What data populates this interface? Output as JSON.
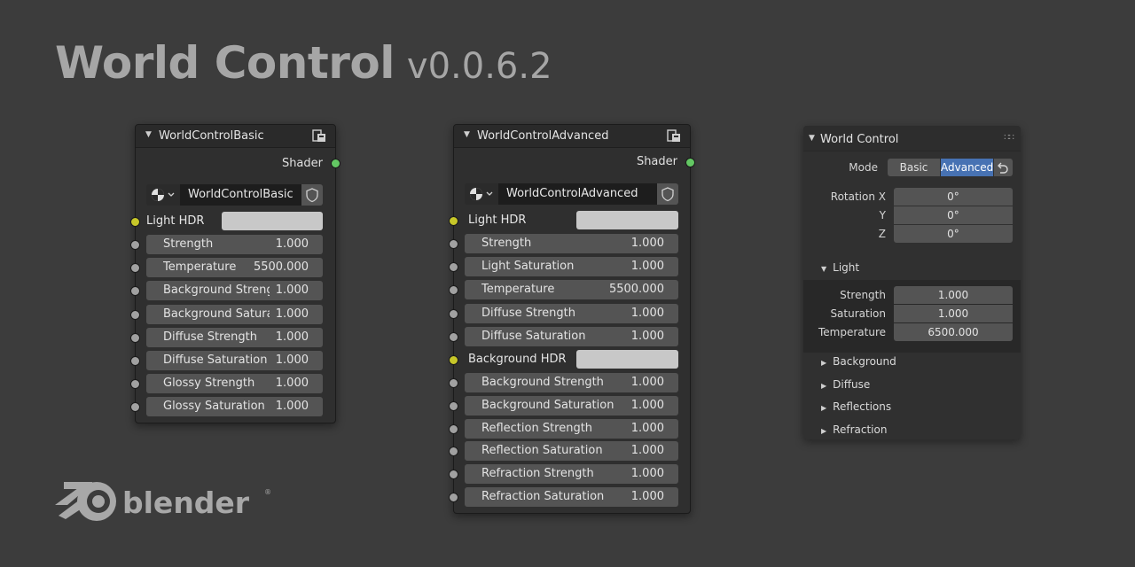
{
  "title": {
    "main": "World Control",
    "version": "v0.0.6.2"
  },
  "nodes": {
    "basic": {
      "title": "WorldControlBasic",
      "output": "Shader",
      "group_name": "WorldControlBasic",
      "hdr_label": "Light HDR",
      "fields": [
        {
          "label": "Strength",
          "value": "1.000"
        },
        {
          "label": "Temperature",
          "value": "5500.000"
        },
        {
          "label": "Background Streng",
          "value": "1.000"
        },
        {
          "label": "Background Satura",
          "value": "1.000"
        },
        {
          "label": "Diffuse Strength",
          "value": "1.000"
        },
        {
          "label": "Diffuse Saturation",
          "value": "1.000"
        },
        {
          "label": "Glossy Strength",
          "value": "1.000"
        },
        {
          "label": "Glossy Saturation",
          "value": "1.000"
        }
      ]
    },
    "advanced": {
      "title": "WorldControlAdvanced",
      "output": "Shader",
      "group_name": "WorldControlAdvanced",
      "hdr_label": "Light HDR",
      "hdr2_label": "Background HDR",
      "fields_a": [
        {
          "label": "Strength",
          "value": "1.000"
        },
        {
          "label": "Light Saturation",
          "value": "1.000"
        },
        {
          "label": "Temperature",
          "value": "5500.000"
        },
        {
          "label": "Diffuse Strength",
          "value": "1.000"
        },
        {
          "label": "Diffuse Saturation",
          "value": "1.000"
        }
      ],
      "fields_b": [
        {
          "label": "Background Strength",
          "value": "1.000"
        },
        {
          "label": "Background Saturation",
          "value": "1.000"
        },
        {
          "label": "Reflection Strength",
          "value": "1.000"
        },
        {
          "label": "Reflection Saturation",
          "value": "1.000"
        },
        {
          "label": "Refraction Strength",
          "value": "1.000"
        },
        {
          "label": "Refraction Saturation",
          "value": "1.000"
        }
      ]
    }
  },
  "panel": {
    "title": "World Control",
    "mode_label": "Mode",
    "mode_options": [
      "Basic",
      "Advanced"
    ],
    "mode_selected": "Advanced",
    "rotation": [
      {
        "label": "Rotation X",
        "value": "0°"
      },
      {
        "label": "Y",
        "value": "0°"
      },
      {
        "label": "Z",
        "value": "0°"
      }
    ],
    "light_header": "Light",
    "light_fields": [
      {
        "label": "Strength",
        "value": "1.000"
      },
      {
        "label": "Saturation",
        "value": "1.000"
      },
      {
        "label": "Temperature",
        "value": "6500.000"
      }
    ],
    "collapsed_sections": [
      "Background",
      "Diffuse",
      "Reflections",
      "Refraction"
    ]
  },
  "logo": {
    "text": "blender"
  },
  "colors": {
    "accent_blue": "#4772b3",
    "socket_green": "#63c763",
    "socket_yellow": "#c7c729",
    "socket_grey": "#a1a1a1"
  }
}
